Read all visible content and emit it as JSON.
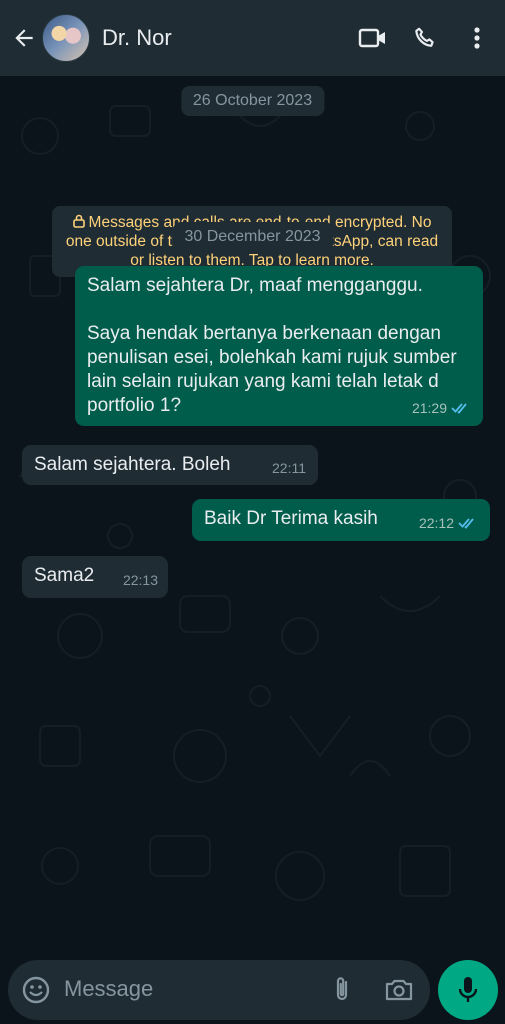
{
  "header": {
    "contact_name": "Dr. Nor",
    "icons": [
      "back-arrow-icon",
      "video-call-icon",
      "voice-call-icon",
      "more-options-icon"
    ]
  },
  "chat": {
    "dates": [
      "26 October 2023",
      "30 December 2023"
    ],
    "encryption_notice": "Messages and calls are end-to-end encrypted. No one outside of this chat, not even WhatsApp, can read or listen to them. Tap to learn more.",
    "messages": [
      {
        "direction": "outgoing",
        "line1": "Salam sejahtera Dr, maaf mengganggu.",
        "line2": "Saya hendak bertanya berkenaan dengan penulisan esei, bolehkah kami rujuk sumber lain selain rujukan yang kami telah letak d portfolio 1?",
        "time": "21:29",
        "status": "read"
      },
      {
        "direction": "incoming",
        "text": "Salam sejahtera. Boleh",
        "time": "22:11"
      },
      {
        "direction": "outgoing",
        "text": "Baik Dr Terima kasih",
        "time": "22:12",
        "status": "read"
      },
      {
        "direction": "incoming",
        "text": "Sama2",
        "time": "22:13"
      }
    ]
  },
  "composer": {
    "placeholder": "Message"
  },
  "colors": {
    "header_bg": "#1f2c34",
    "chat_bg": "#0b141a",
    "outgoing_bubble": "#005c4b",
    "incoming_bubble": "#1f2c34",
    "accent_green": "#00a884",
    "read_ticks": "#53bdeb",
    "encryption_text": "#ffd279"
  }
}
